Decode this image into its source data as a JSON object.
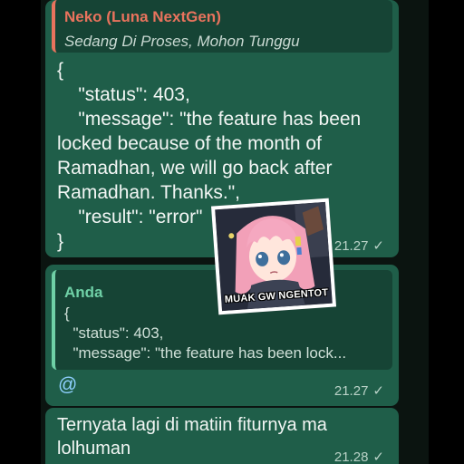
{
  "messages": [
    {
      "quote": {
        "author": "Neko (Luna NextGen)",
        "subtitle": "Sedang Di Proses, Mohon Tunggu"
      },
      "lines": [
        "{",
        "    \"status\": 403,",
        "    \"message\": \"the feature has been",
        "locked because of the month of",
        "Ramadhan, we will go back after",
        "Ramadhan. Thanks.\",",
        "    \"result\": \"error\"",
        "}"
      ],
      "time": "21.27",
      "status": "✓"
    },
    {
      "quote": {
        "author": "Anda",
        "lines": [
          "{",
          "  \"status\": 403,",
          "  \"message\": \"the feature has been lock..."
        ]
      },
      "mention": "@",
      "time": "21.27",
      "status": "✓"
    },
    {
      "lines": [
        "Ternyata lagi di matiin fiturnya ma",
        "lolhuman"
      ],
      "time": "21.28",
      "status": "✓"
    }
  ],
  "sticker": {
    "caption": "MUAK GW NGENTOT"
  },
  "colors": {
    "bubble": "#1f5e49",
    "quote_author_1": "#e9735d",
    "quote_author_2": "#6fd0a6",
    "mention": "#8fd0ff"
  }
}
